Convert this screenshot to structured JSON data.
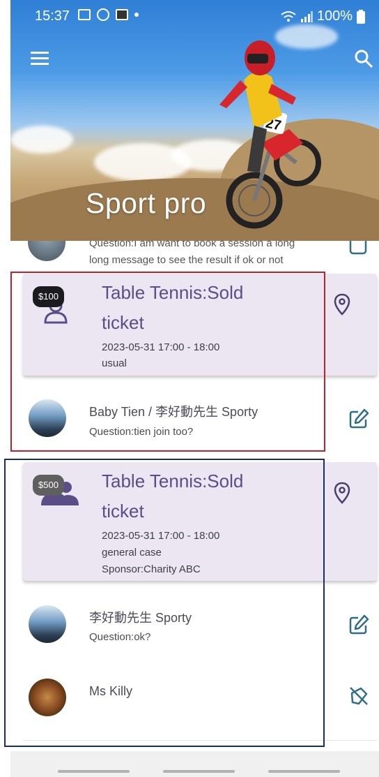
{
  "status_bar": {
    "time": "15:37",
    "battery": "100%"
  },
  "header": {
    "title": "Sport pro"
  },
  "peek_item": {
    "question_line1": "Question:I am want to book a session a long",
    "question_line2": "long message to see the result if ok or not"
  },
  "events": [
    {
      "badge": "$100",
      "badge_color": "#1c1b1f",
      "title_line1": "Table Tennis:Sold",
      "title_line2": "ticket",
      "datetime": "2023-05-31 17:00 - 18:00",
      "case": "usual",
      "participants": [
        {
          "name": "Baby Tien  / 李好動先生 Sporty",
          "question": "Question:tien join too?"
        }
      ]
    },
    {
      "badge": "$500",
      "badge_color": "#5f5f5f",
      "title_line1": "Table Tennis:Sold",
      "title_line2": "ticket",
      "datetime": "2023-05-31 17:00 - 18:00",
      "case": "general case",
      "sponsor": "Sponsor:Charity ABC",
      "participants": [
        {
          "name_prefix": "李好動先生",
          "name_bold": "Sporty",
          "question": "Question:ok?"
        },
        {
          "name": "Ms Killy"
        }
      ]
    }
  ],
  "colors": {
    "accent": "#5b4e86",
    "card_bg": "#ebe6f2",
    "edit_icon": "#2f6f86",
    "highlight_red": "#c0202a",
    "highlight_blue": "#17305e"
  }
}
